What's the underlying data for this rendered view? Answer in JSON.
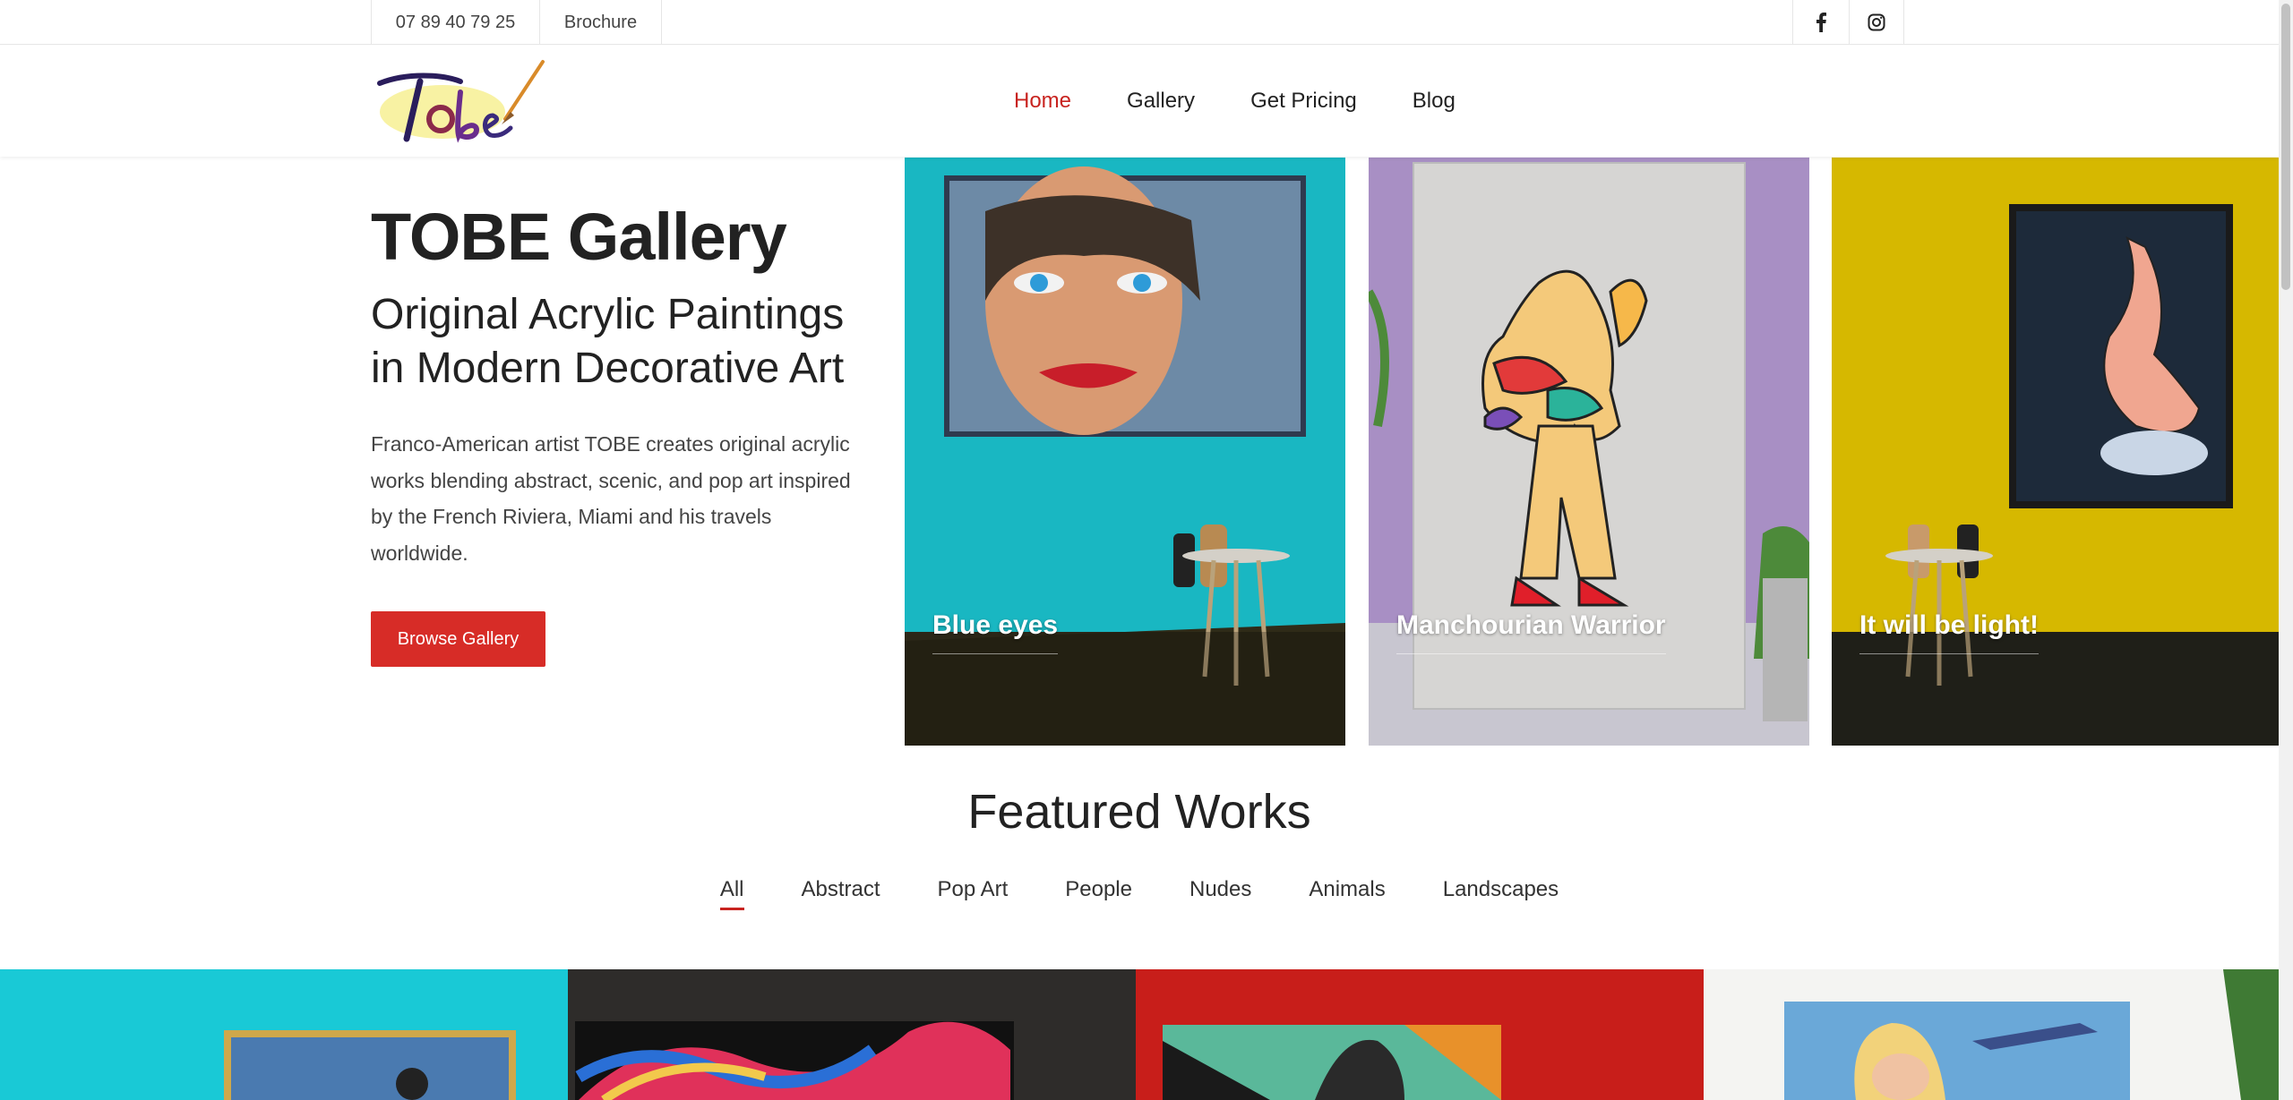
{
  "topbar": {
    "phone": "07 89 40 79 25",
    "brochure": "Brochure",
    "facebook_icon": "facebook-icon",
    "instagram_icon": "instagram-icon"
  },
  "header": {
    "logo_text": "Tobe",
    "nav": [
      {
        "label": "Home",
        "active": true
      },
      {
        "label": "Gallery",
        "active": false
      },
      {
        "label": "Get Pricing",
        "active": false
      },
      {
        "label": "Blog",
        "active": false
      }
    ]
  },
  "hero": {
    "title": "TOBE Gallery",
    "subtitle": "Original Acrylic Paintings in Modern Decorative Art",
    "description": "Franco-American artist TOBE creates original acrylic works blending abstract, scenic, and pop art inspired by the French Riviera, Miami and his travels worldwide.",
    "button": "Browse Gallery"
  },
  "cards": [
    {
      "caption": "Blue eyes"
    },
    {
      "caption": "Manchourian Warrior"
    },
    {
      "caption": "It will be light!"
    }
  ],
  "featured": {
    "title": "Featured Works",
    "filters": [
      "All",
      "Abstract",
      "Pop Art",
      "People",
      "Nudes",
      "Animals",
      "Landscapes"
    ],
    "active_filter": "All"
  },
  "colors": {
    "accent": "#c8231f",
    "button": "#d72c27"
  }
}
